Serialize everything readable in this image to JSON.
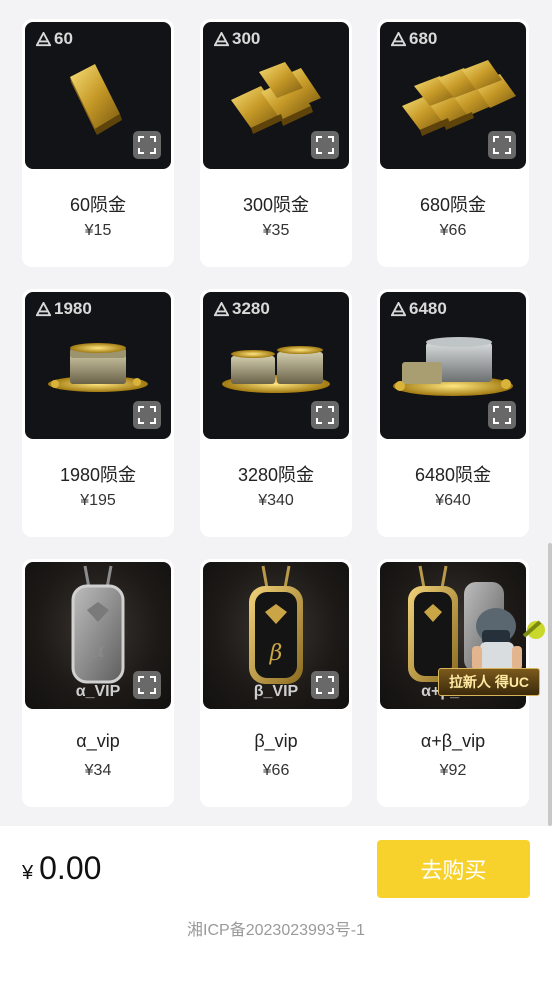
{
  "products": [
    {
      "badge": "60",
      "title": "60陨金",
      "price": "¥15",
      "kind": "gold-bar-single"
    },
    {
      "badge": "300",
      "title": "300陨金",
      "price": "¥35",
      "kind": "gold-bar-pile"
    },
    {
      "badge": "680",
      "title": "680陨金",
      "price": "¥66",
      "kind": "gold-bar-pile-large"
    },
    {
      "badge": "1980",
      "title": "1980陨金",
      "price": "¥195",
      "kind": "gold-chest"
    },
    {
      "badge": "3280",
      "title": "3280陨金",
      "price": "¥340",
      "kind": "gold-chest"
    },
    {
      "badge": "6480",
      "title": "6480陨金",
      "price": "¥640",
      "kind": "gold-chest-large"
    },
    {
      "vip_tag": "α_VIP",
      "title": "α_vip",
      "price": "¥34",
      "kind": "pendant-silver"
    },
    {
      "vip_tag": "β_VIP",
      "title": "β_vip",
      "price": "¥66",
      "kind": "pendant-gold"
    },
    {
      "vip_tag": "α+β_VIP",
      "title": "α+β_vip",
      "price": "¥92",
      "kind": "pendant-combo"
    }
  ],
  "footer": {
    "currency": "¥",
    "total": "0.00",
    "buy_label": "去购买",
    "icp": "湘ICP备2023023993号-1"
  },
  "promo": {
    "label": "拉新人 得UC"
  },
  "colors": {
    "buy_button": "#f7d22d",
    "card_bg": "#ffffff",
    "page_bg": "#f3f3f6",
    "thumb_bg": "#121316"
  }
}
